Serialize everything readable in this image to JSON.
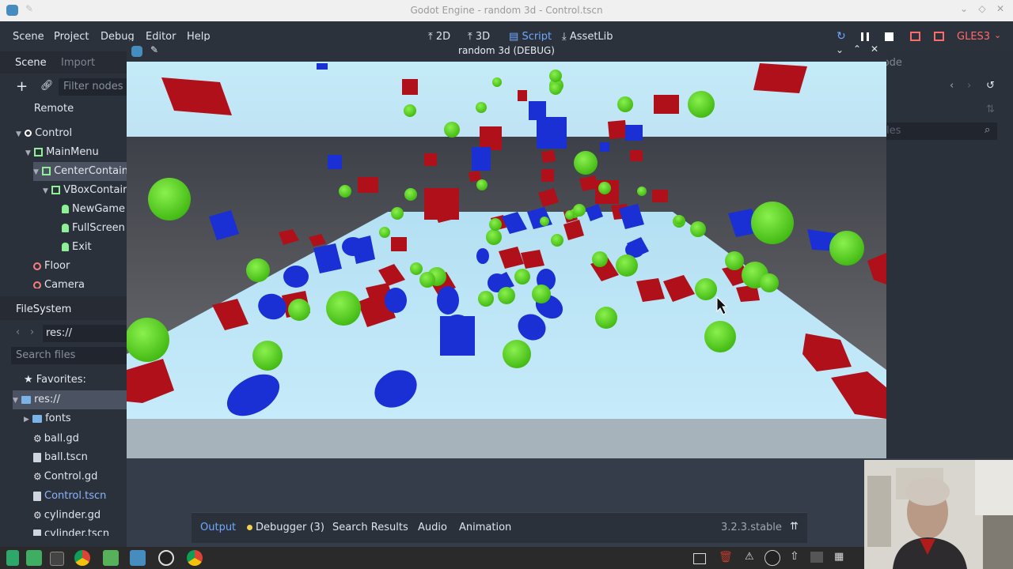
{
  "window": {
    "title": "Godot Engine - random 3d - Control.tscn"
  },
  "menubar": {
    "menus": [
      "Scene",
      "Project",
      "Debug",
      "Editor",
      "Help"
    ],
    "workspace": {
      "2d": "2D",
      "3d": "3D",
      "script": "Script",
      "assetlib": "AssetLib"
    },
    "renderer": "GLES3"
  },
  "scene_dock": {
    "tabs": {
      "scene": "Scene",
      "import": "Import"
    },
    "filter_placeholder": "Filter nodes",
    "remote_label": "Remote",
    "nodes": [
      "Control",
      "MainMenu",
      "CenterContain",
      "VBoxContain",
      "NewGame",
      "FullScreen",
      "Exit",
      "Floor",
      "Camera"
    ]
  },
  "filesystem": {
    "title": "FileSystem",
    "path": "res://",
    "search_placeholder": "Search files",
    "favorites": "Favorites:",
    "root": "res://",
    "items": [
      "fonts",
      "ball.gd",
      "ball.tscn",
      "Control.gd",
      "Control.tscn",
      "cylinder.gd",
      "cylinder.tscn"
    ]
  },
  "right_dock": {
    "tab": "Node",
    "filter": "les"
  },
  "game_window": {
    "title": "random 3d (DEBUG)"
  },
  "bottom_panel": {
    "tabs": {
      "output": "Output",
      "debugger": "Debugger (3)",
      "search": "Search Results",
      "audio": "Audio",
      "animation": "Animation"
    },
    "version": "3.2.3.stable"
  },
  "colors": {
    "accent": "#6fa8ff",
    "sky": "#bfe6f7",
    "red_box": "#b0101a",
    "blue": "#1a2fd4",
    "green": "#55d41c"
  }
}
